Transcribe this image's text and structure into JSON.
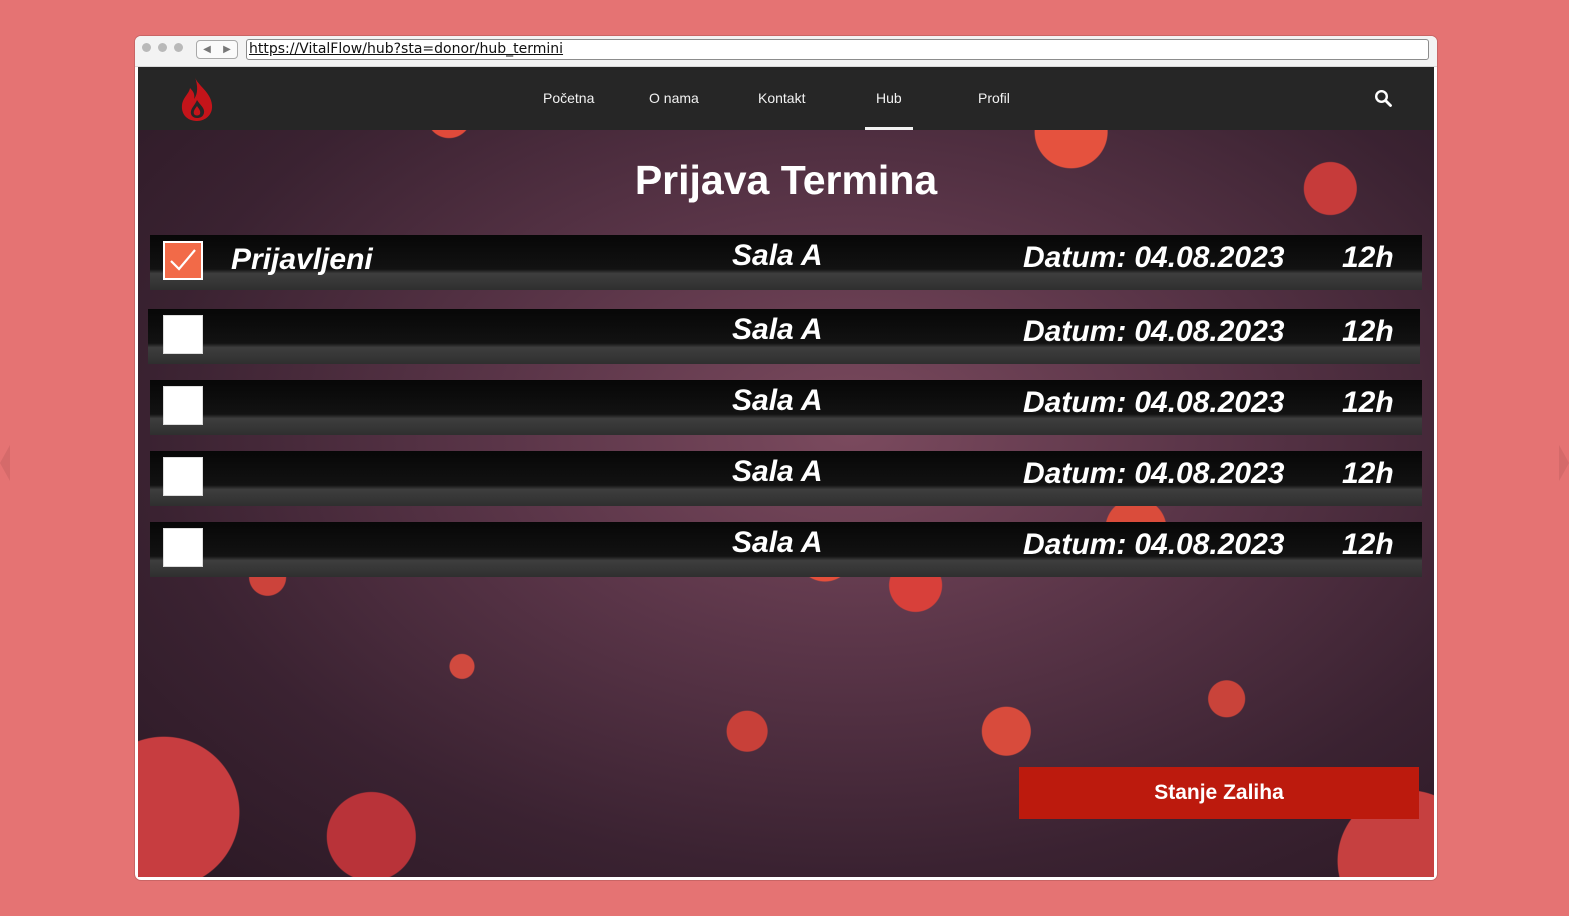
{
  "browser": {
    "url": "https://VitalFlow/hub?sta=donor/hub_termini",
    "back_glyph": "◀",
    "forward_glyph": "▶"
  },
  "navbar": {
    "logo_icon": "blood-drop-flame-icon",
    "items": [
      {
        "label": "Početna"
      },
      {
        "label": "O nama"
      },
      {
        "label": "Kontakt"
      },
      {
        "label": "Hub",
        "active": true
      },
      {
        "label": "Profil"
      }
    ],
    "search_icon": "search-icon"
  },
  "main": {
    "title": "Prijava Termina",
    "appointments": [
      {
        "checked": true,
        "status": "Prijavljeni",
        "hall": "Sala A",
        "date_label": "Datum:",
        "date": "04.08.2023",
        "time": "12h"
      },
      {
        "checked": false,
        "status": "",
        "hall": "Sala A",
        "date_label": "Datum:",
        "date": "04.08.2023",
        "time": "12h"
      },
      {
        "checked": false,
        "status": "",
        "hall": "Sala A",
        "date_label": "Datum:",
        "date": "04.08.2023",
        "time": "12h"
      },
      {
        "checked": false,
        "status": "",
        "hall": "Sala A",
        "date_label": "Datum:",
        "date": "04.08.2023",
        "time": "12h"
      },
      {
        "checked": false,
        "status": "",
        "hall": "Sala A",
        "date_label": "Datum:",
        "date": "04.08.2023",
        "time": "12h"
      }
    ],
    "stock_button_label": "Stanje Zaliha"
  },
  "colors": {
    "background": "#e57373",
    "navbar": "#262626",
    "accent_red": "#bc1a0d",
    "checkbox_checked": "#f26a48"
  }
}
